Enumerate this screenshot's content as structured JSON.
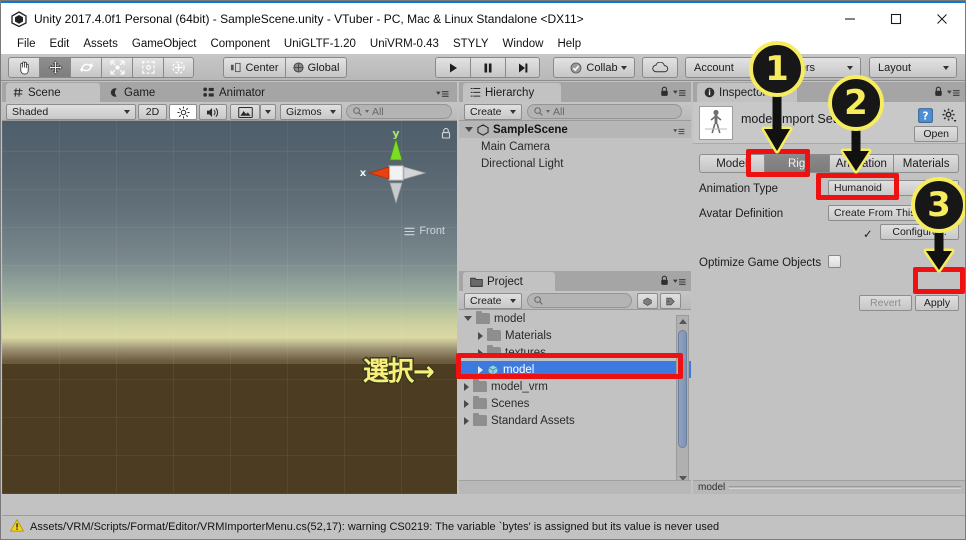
{
  "window": {
    "title": "Unity 2017.4.0f1 Personal (64bit) - SampleScene.unity - VTuber - PC, Mac & Linux Standalone <DX11>",
    "minimize": "—",
    "maximize": "□",
    "close": "✕"
  },
  "menubar": {
    "items": [
      "File",
      "Edit",
      "Assets",
      "GameObject",
      "Component",
      "UniGLTF-1.20",
      "UniVRM-0.43",
      "STYLY",
      "Window",
      "Help"
    ]
  },
  "toolbar": {
    "transform_tools": [
      "hand-tool",
      "move-tool",
      "rotate-tool",
      "scale-tool",
      "rect-tool",
      "transform-tool"
    ],
    "pivot_mode": "Center",
    "pivot_rotation": "Global",
    "play": "play-icon",
    "pause": "pause-icon",
    "step": "step-icon",
    "collab": "Collab",
    "cloud": "cloud-icon",
    "account": "Account",
    "layers": "Layers",
    "layout": "Layout"
  },
  "scene": {
    "tabs": [
      {
        "label": "Scene",
        "icon": "grid-icon",
        "active": true
      },
      {
        "label": "Game",
        "icon": "gamepad-icon",
        "active": false
      },
      {
        "label": "Animator",
        "icon": "animator-icon",
        "active": false
      }
    ],
    "draw_mode": "Shaded",
    "view_2d": "2D",
    "lighting": "sun-icon",
    "audio": "speaker-icon",
    "fx": "image-icon",
    "gizmos": "Gizmos",
    "search_placeholder": "All",
    "gizmo_axes": {
      "y": "y",
      "x": "x"
    },
    "view_orientation": "Front"
  },
  "hierarchy": {
    "tab_label": "Hierarchy",
    "create_label": "Create",
    "search_placeholder": "All",
    "items": [
      {
        "label": "SampleScene",
        "type": "scene",
        "depth": 0
      },
      {
        "label": "Main Camera",
        "type": "gameobject",
        "depth": 1
      },
      {
        "label": "Directional Light",
        "type": "gameobject",
        "depth": 1
      }
    ]
  },
  "project": {
    "tab_label": "Project",
    "create_label": "Create",
    "search_placeholder": "",
    "items": [
      {
        "label": "model",
        "type": "folder",
        "depth": 0,
        "expanded": true,
        "selected": false
      },
      {
        "label": "Materials",
        "type": "folder",
        "depth": 1,
        "expanded": false,
        "selected": false
      },
      {
        "label": "textures",
        "type": "folder",
        "depth": 1,
        "expanded": false,
        "selected": false
      },
      {
        "label": "model",
        "type": "prefab",
        "depth": 1,
        "expanded": false,
        "selected": true
      },
      {
        "label": "model_vrm",
        "type": "folder",
        "depth": 0,
        "expanded": false,
        "selected": false
      },
      {
        "label": "Scenes",
        "type": "folder",
        "depth": 0,
        "expanded": false,
        "selected": false
      },
      {
        "label": "Standard Assets",
        "type": "folder",
        "depth": 0,
        "expanded": false,
        "selected": false
      }
    ]
  },
  "inspector": {
    "tab_label": "Inspector",
    "asset_title": "model Import Settings",
    "help_icon": "book-icon",
    "preset_icon": "gear-icon",
    "open_label": "Open",
    "tabs": [
      {
        "label": "Model",
        "active": false
      },
      {
        "label": "Rig",
        "active": true
      },
      {
        "label": "Animation",
        "active": false
      },
      {
        "label": "Materials",
        "active": false
      }
    ],
    "fields": [
      {
        "label": "Animation Type",
        "value": "Humanoid"
      },
      {
        "label": "Avatar Definition",
        "value": "Create From This Model"
      },
      {
        "label": "",
        "value": "Configure..."
      },
      {
        "label": "Optimize Game Objects",
        "value": ""
      }
    ],
    "revert_label": "Revert",
    "apply_label": "Apply",
    "footer_label": "model"
  },
  "status": {
    "icon": "warning-icon",
    "message": "Assets/VRM/Scripts/Format/Editor/VRMImporterMenu.cs(52,17): warning CS0219: The variable `bytes' is assigned but its value is never used"
  },
  "annotations": {
    "badges": [
      "1",
      "2",
      "3"
    ],
    "japanese_label": "選択→",
    "highlight_color": "#ee1111",
    "badge_color": "#f6ec5e"
  }
}
